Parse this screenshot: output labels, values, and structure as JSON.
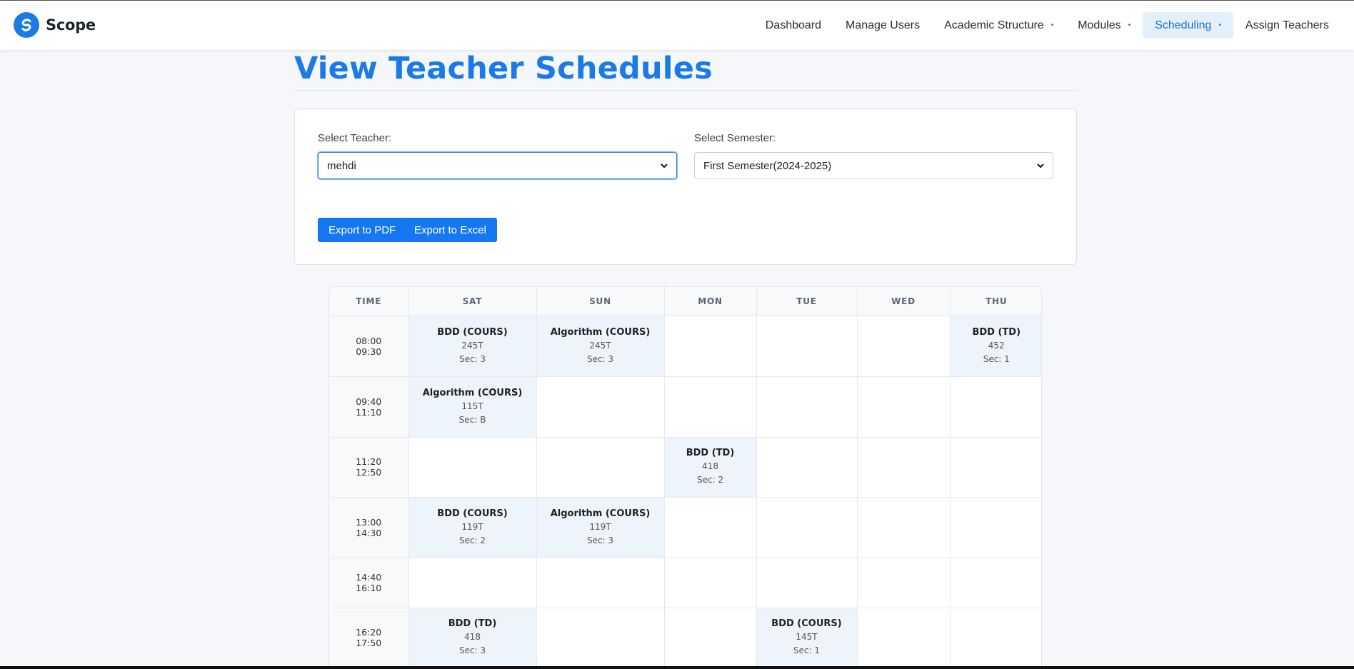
{
  "brand": {
    "name": "Scope",
    "color": "#1a7be8"
  },
  "nav": [
    {
      "label": "Dashboard",
      "dropdown": false,
      "active": false
    },
    {
      "label": "Manage Users",
      "dropdown": false,
      "active": false
    },
    {
      "label": "Academic Structure",
      "dropdown": true,
      "active": false
    },
    {
      "label": "Modules",
      "dropdown": true,
      "active": false
    },
    {
      "label": "Scheduling",
      "dropdown": true,
      "active": true
    },
    {
      "label": "Assign Teachers",
      "dropdown": false,
      "active": false
    }
  ],
  "page": {
    "title": "View Teacher Schedules"
  },
  "filters": {
    "teacher": {
      "label": "Select Teacher:",
      "value": "mehdi"
    },
    "semester": {
      "label": "Select Semester:",
      "value": "First Semester(2024-2025)"
    }
  },
  "actions": {
    "export_pdf": "Export to PDF",
    "export_excel": "Export to Excel"
  },
  "schedule": {
    "columns": [
      "TIME",
      "SAT",
      "SUN",
      "MON",
      "TUE",
      "WED",
      "THU"
    ],
    "rows": [
      {
        "start": "08:00",
        "end": "09:30",
        "cells": [
          {
            "course": "BDD (COURS)",
            "room": "245T",
            "section": "Sec: 3"
          },
          {
            "course": "Algorithm (COURS)",
            "room": "245T",
            "section": "Sec: 3"
          },
          null,
          null,
          null,
          {
            "course": "BDD (TD)",
            "room": "452",
            "section": "Sec: 1"
          }
        ]
      },
      {
        "start": "09:40",
        "end": "11:10",
        "cells": [
          {
            "course": "Algorithm (COURS)",
            "room": "115T",
            "section": "Sec: B"
          },
          null,
          null,
          null,
          null,
          null
        ]
      },
      {
        "start": "11:20",
        "end": "12:50",
        "cells": [
          null,
          null,
          {
            "course": "BDD (TD)",
            "room": "418",
            "section": "Sec: 2"
          },
          null,
          null,
          null
        ]
      },
      {
        "start": "13:00",
        "end": "14:30",
        "cells": [
          {
            "course": "BDD (COURS)",
            "room": "119T",
            "section": "Sec: 2"
          },
          {
            "course": "Algorithm (COURS)",
            "room": "119T",
            "section": "Sec: 3"
          },
          null,
          null,
          null,
          null
        ]
      },
      {
        "start": "14:40",
        "end": "16:10",
        "cells": [
          null,
          null,
          null,
          null,
          null,
          null
        ]
      },
      {
        "start": "16:20",
        "end": "17:50",
        "cells": [
          {
            "course": "BDD (TD)",
            "room": "418",
            "section": "Sec: 3"
          },
          null,
          null,
          {
            "course": "BDD (COURS)",
            "room": "145T",
            "section": "Sec: 1"
          },
          null,
          null
        ]
      }
    ]
  }
}
